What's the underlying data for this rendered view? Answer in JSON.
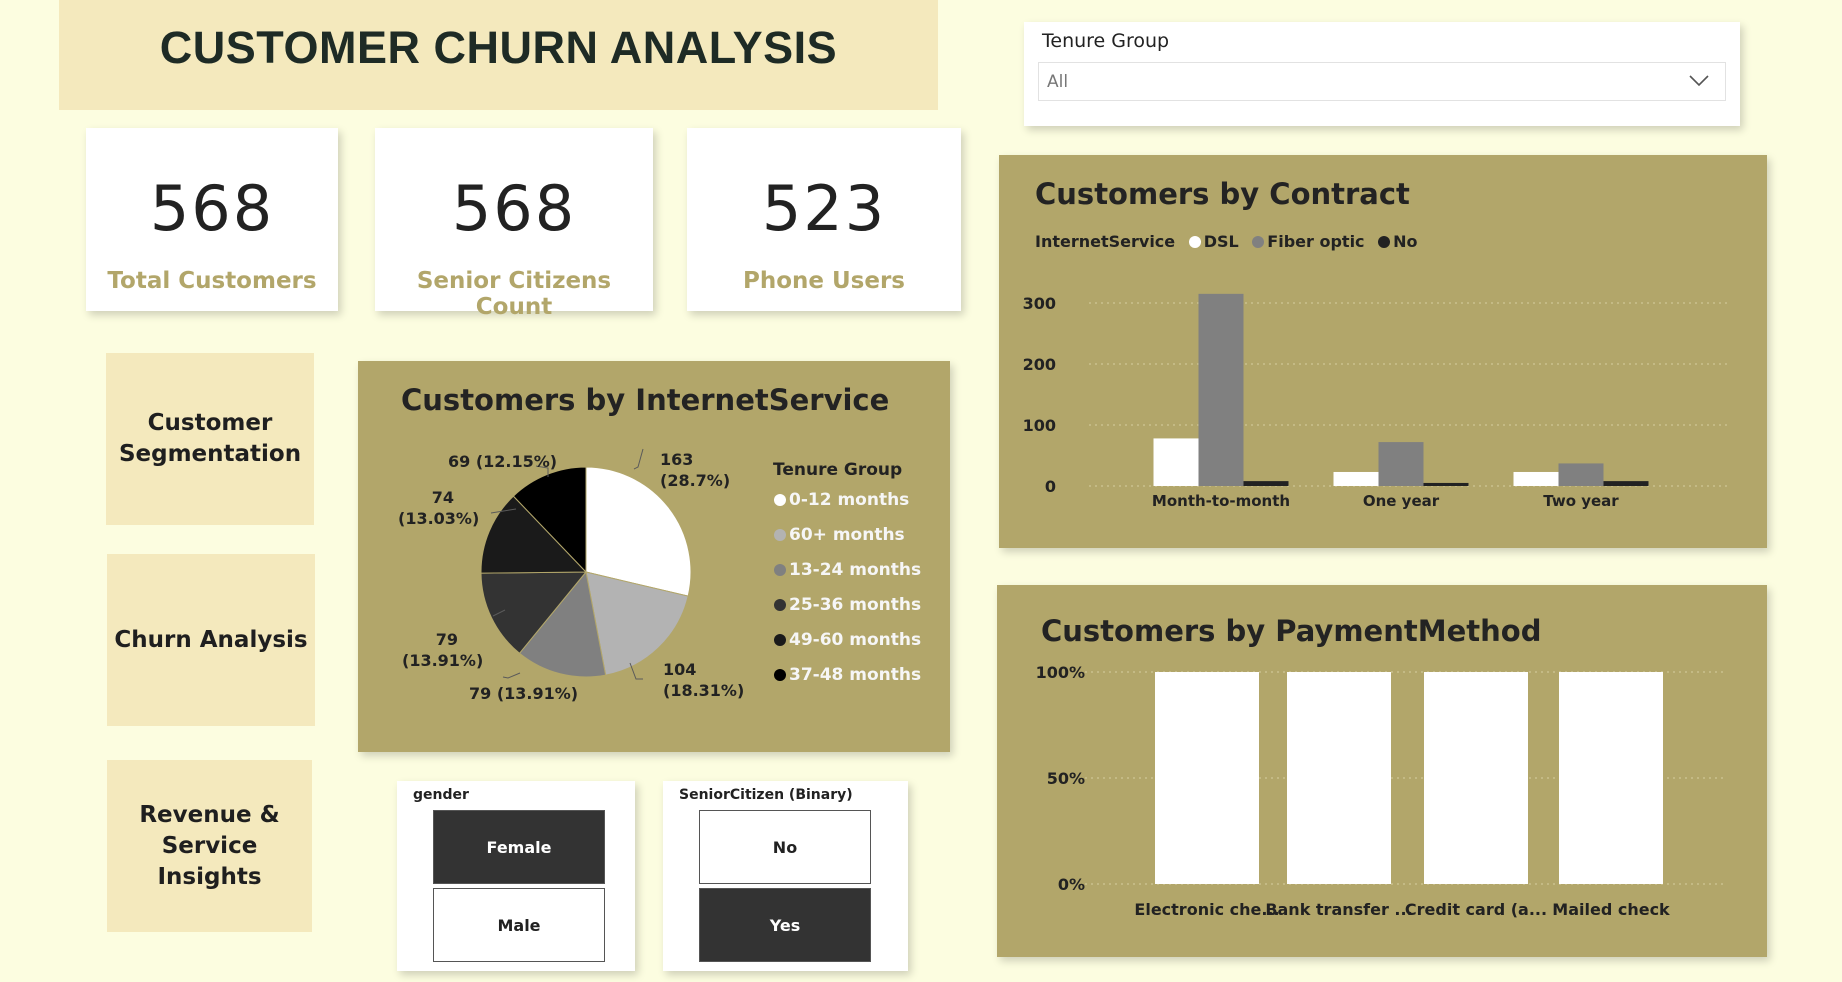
{
  "title": "CUSTOMER CHURN ANALYSIS",
  "colors": {
    "background": "#fcfde0",
    "panel": "#b2a66a",
    "accent_light": "#f4e9bd",
    "label_gold": "#b2a66a"
  },
  "kpis": [
    {
      "value": "568",
      "label": "Total Customers"
    },
    {
      "value": "568",
      "label": "Senior Citizens Count"
    },
    {
      "value": "523",
      "label": "Phone Users"
    }
  ],
  "nav": {
    "segmentation": "Customer Segmentation",
    "churn": "Churn Analysis",
    "revenue": "Revenue & Service Insights"
  },
  "tenure_slicer": {
    "label": "Tenure Group",
    "value": "All",
    "icon": "chevron-down-icon"
  },
  "chart_data": [
    {
      "type": "pie",
      "title": "Customers by InternetService",
      "legend_title": "Tenure Group",
      "legend_placement": "right",
      "slices": [
        {
          "label": "0-12 months",
          "value": 163,
          "display": "163",
          "pct": "(28.7%)",
          "color": "#ffffff"
        },
        {
          "label": "60+ months",
          "value": 104,
          "display": "104",
          "pct": "(18.31%)",
          "color": "#b3b3b3"
        },
        {
          "label": "13-24 months",
          "value": 79,
          "display": "79 (13.91%)",
          "pct": "",
          "color": "#808080"
        },
        {
          "label": "25-36 months",
          "value": 79,
          "display": "79",
          "pct": "(13.91%)",
          "color": "#333333"
        },
        {
          "label": "49-60 months",
          "value": 74,
          "display": "74",
          "pct": "(13.03%)",
          "color": "#1a1a1a"
        },
        {
          "label": "37-48 months",
          "value": 69,
          "display": "69 (12.15%)",
          "pct": "",
          "color": "#000000"
        }
      ]
    },
    {
      "type": "bar",
      "title": "Customers by Contract",
      "legend_title": "InternetService",
      "legend_placement": "top-left",
      "categories": [
        "Month-to-month",
        "One year",
        "Two year"
      ],
      "series": [
        {
          "name": "DSL",
          "values": [
            78,
            23,
            23
          ],
          "color": "#ffffff"
        },
        {
          "name": "Fiber optic",
          "values": [
            315,
            72,
            37
          ],
          "color": "#808080"
        },
        {
          "name": "No",
          "values": [
            8,
            5,
            8
          ],
          "color": "#222222"
        }
      ],
      "yticks": [
        0,
        100,
        200,
        300
      ],
      "ylim": [
        0,
        330
      ],
      "grid": true
    },
    {
      "type": "bar",
      "title": "Customers by PaymentMethod",
      "categories": [
        "Electronic che...",
        "Bank transfer ...",
        "Credit card (a...",
        "Mailed check"
      ],
      "values": [
        100,
        100,
        100,
        100
      ],
      "yticks": [
        "0%",
        "50%",
        "100%"
      ],
      "ylim": [
        0,
        100
      ],
      "grid": true,
      "color": "#ffffff"
    }
  ],
  "gender_slicer": {
    "header": "gender",
    "options": [
      "Female",
      "Male"
    ],
    "selected": "Female"
  },
  "senior_slicer": {
    "header": "SeniorCitizen (Binary)",
    "options": [
      "No",
      "Yes"
    ],
    "selected": "Yes"
  }
}
